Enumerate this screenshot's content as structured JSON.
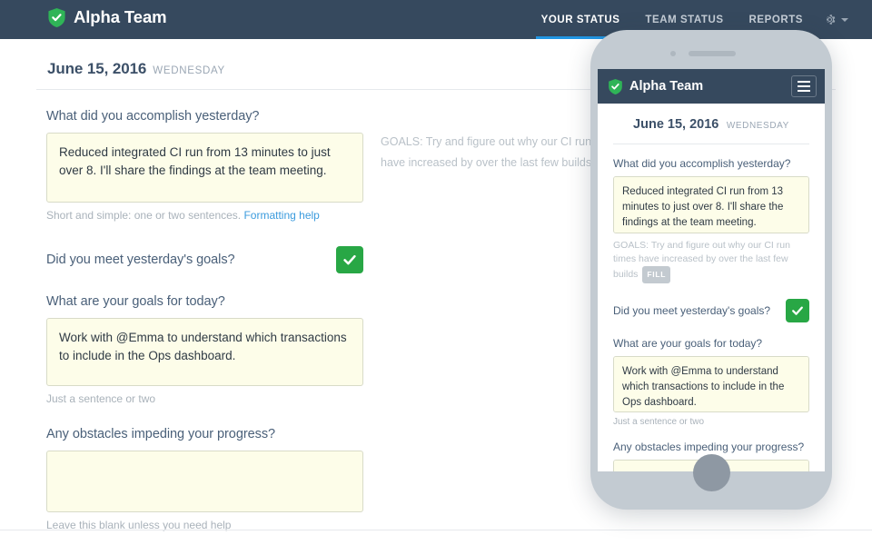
{
  "brand": {
    "name": "Alpha Team",
    "logo_icon": "shield-check-icon",
    "logo_color": "#2fb457"
  },
  "nav": {
    "items": [
      {
        "label": "YOUR STATUS",
        "active": true
      },
      {
        "label": "TEAM STATUS",
        "active": false
      },
      {
        "label": "REPORTS",
        "active": false
      }
    ],
    "settings_icon": "gear-icon",
    "settings_caret_icon": "chevron-down-icon",
    "active_accent_color": "#2196e3"
  },
  "date": {
    "main": "June 15, 2016",
    "day_of_week": "WEDNESDAY"
  },
  "form": {
    "q1": {
      "label": "What did you accomplish yesterday?",
      "value": "Reduced integrated CI run from 13 minutes to just over 8. I'll share the findings at the team meeting.",
      "placeholder": "",
      "hint_text": "Short and simple: one or two sentences.",
      "hint_link": "Formatting help"
    },
    "q2": {
      "label": "Did you meet yesterday's goals?",
      "checked": true,
      "check_icon": "checkmark-icon",
      "check_color": "#28a745"
    },
    "q3": {
      "label": "What are your goals for today?",
      "value": "Work with @Emma to understand which transactions to include in the Ops dashboard.",
      "placeholder": "",
      "hint_text": "Just a sentence or two"
    },
    "q4": {
      "label": "Any obstacles impeding your progress?",
      "value": "",
      "placeholder": "",
      "hint_text": "Leave this blank unless you need help"
    }
  },
  "goals_note": {
    "prefix": "GOALS:",
    "text": "Try and figure out why our CI run times have increased by over the last few builds",
    "badge": "FILL"
  },
  "phone": {
    "brand_name": "Alpha Team",
    "logo_icon": "shield-check-icon",
    "menu_icon": "hamburger-menu-icon",
    "date_main": "June 15, 2016",
    "date_dow": "WEDNESDAY",
    "q1_label": "What did you accomplish yesterday?",
    "q1_value": "Reduced integrated CI run from 13 minutes to just over 8. I'll share the findings at the team meeting.",
    "goals_prefix": "GOALS:",
    "goals_text": "Try and figure out why our CI run times have increased by over the last few builds",
    "goals_badge": "FILL",
    "q2_label": "Did you meet yesterday's goals?",
    "q2_check_icon": "checkmark-icon",
    "q3_label": "What are your goals for today?",
    "q3_value": "Work with @Emma to understand which transactions to include in the Ops dashboard.",
    "q3_hint": "Just a sentence or two",
    "q4_label": "Any obstacles impeding your progress?",
    "q4_value": "",
    "home_button_icon": "home-button-icon",
    "camera_icon": "front-camera-icon",
    "speaker_icon": "earpiece-speaker-icon"
  }
}
